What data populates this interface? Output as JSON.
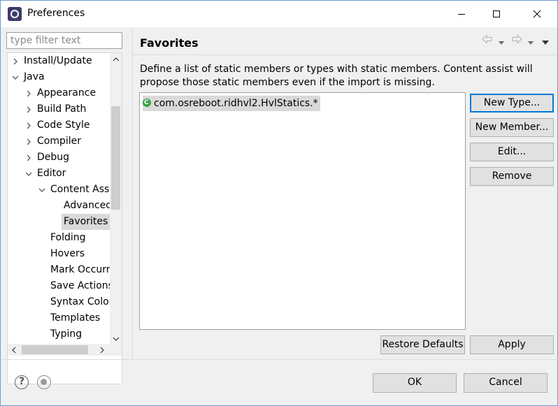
{
  "window": {
    "title": "Preferences"
  },
  "sidebar": {
    "filter_placeholder": "type filter text",
    "tree": [
      {
        "label": "Install/Update",
        "expanded": false
      },
      {
        "label": "Java",
        "expanded": true
      },
      {
        "label": "Appearance",
        "expanded": false
      },
      {
        "label": "Build Path",
        "expanded": false
      },
      {
        "label": "Code Style",
        "expanded": false
      },
      {
        "label": "Compiler",
        "expanded": false
      },
      {
        "label": "Debug",
        "expanded": false
      },
      {
        "label": "Editor",
        "expanded": true
      },
      {
        "label": "Content Assi",
        "expanded": true
      },
      {
        "label": "Advanced"
      },
      {
        "label": "Favorites",
        "selected": true
      },
      {
        "label": "Folding"
      },
      {
        "label": "Hovers"
      },
      {
        "label": "Mark Occurre"
      },
      {
        "label": "Save Actions"
      },
      {
        "label": "Syntax Color"
      },
      {
        "label": "Templates"
      },
      {
        "label": "Typing"
      }
    ]
  },
  "page": {
    "title": "Favorites",
    "description": "Define a list of static members or types with static members. Content assist will propose those static members even if the import is missing.",
    "favorites": [
      {
        "label": "com.osreboot.ridhvl2.HvlStatics.*",
        "icon": "class-icon"
      }
    ],
    "buttons": {
      "new_type": "New Type...",
      "new_member": "New Member...",
      "edit": "Edit...",
      "remove": "Remove",
      "restore_defaults": "Restore Defaults",
      "apply": "Apply"
    }
  },
  "footer": {
    "ok": "OK",
    "cancel": "Cancel"
  },
  "colors": {
    "accent": "#0078d7",
    "selection": "#d9d9d9",
    "button_bg": "#e1e1e1"
  }
}
